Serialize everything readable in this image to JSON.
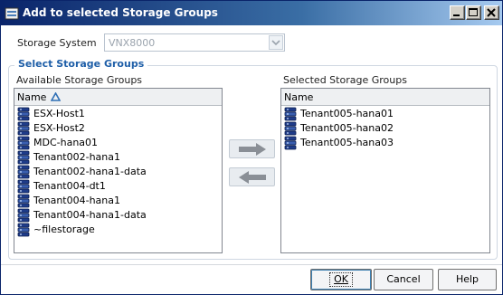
{
  "window": {
    "title": "Add to selected Storage Groups"
  },
  "storage_system": {
    "label": "Storage System",
    "value": "VNX8000"
  },
  "group": {
    "title": "Select Storage Groups"
  },
  "available": {
    "label": "Available Storage Groups",
    "column_header": "Name",
    "items": [
      "ESX-Host1",
      "ESX-Host2",
      "MDC-hana01",
      "Tenant002-hana1",
      "Tenant002-hana1-data",
      "Tenant004-dt1",
      "Tenant004-hana1",
      "Tenant004-hana1-data",
      "~filestorage"
    ]
  },
  "selected": {
    "label": "Selected Storage Groups",
    "column_header": "Name",
    "items": [
      "Tenant005-hana01",
      "Tenant005-hana02",
      "Tenant005-hana03"
    ]
  },
  "buttons": {
    "ok": "OK",
    "cancel": "Cancel",
    "help": "Help"
  },
  "icons": {
    "title": "app-icon",
    "item": "storage-group-icon",
    "add": "arrow-right-icon",
    "remove": "arrow-left-icon",
    "sort": "sort-ascending-icon"
  }
}
